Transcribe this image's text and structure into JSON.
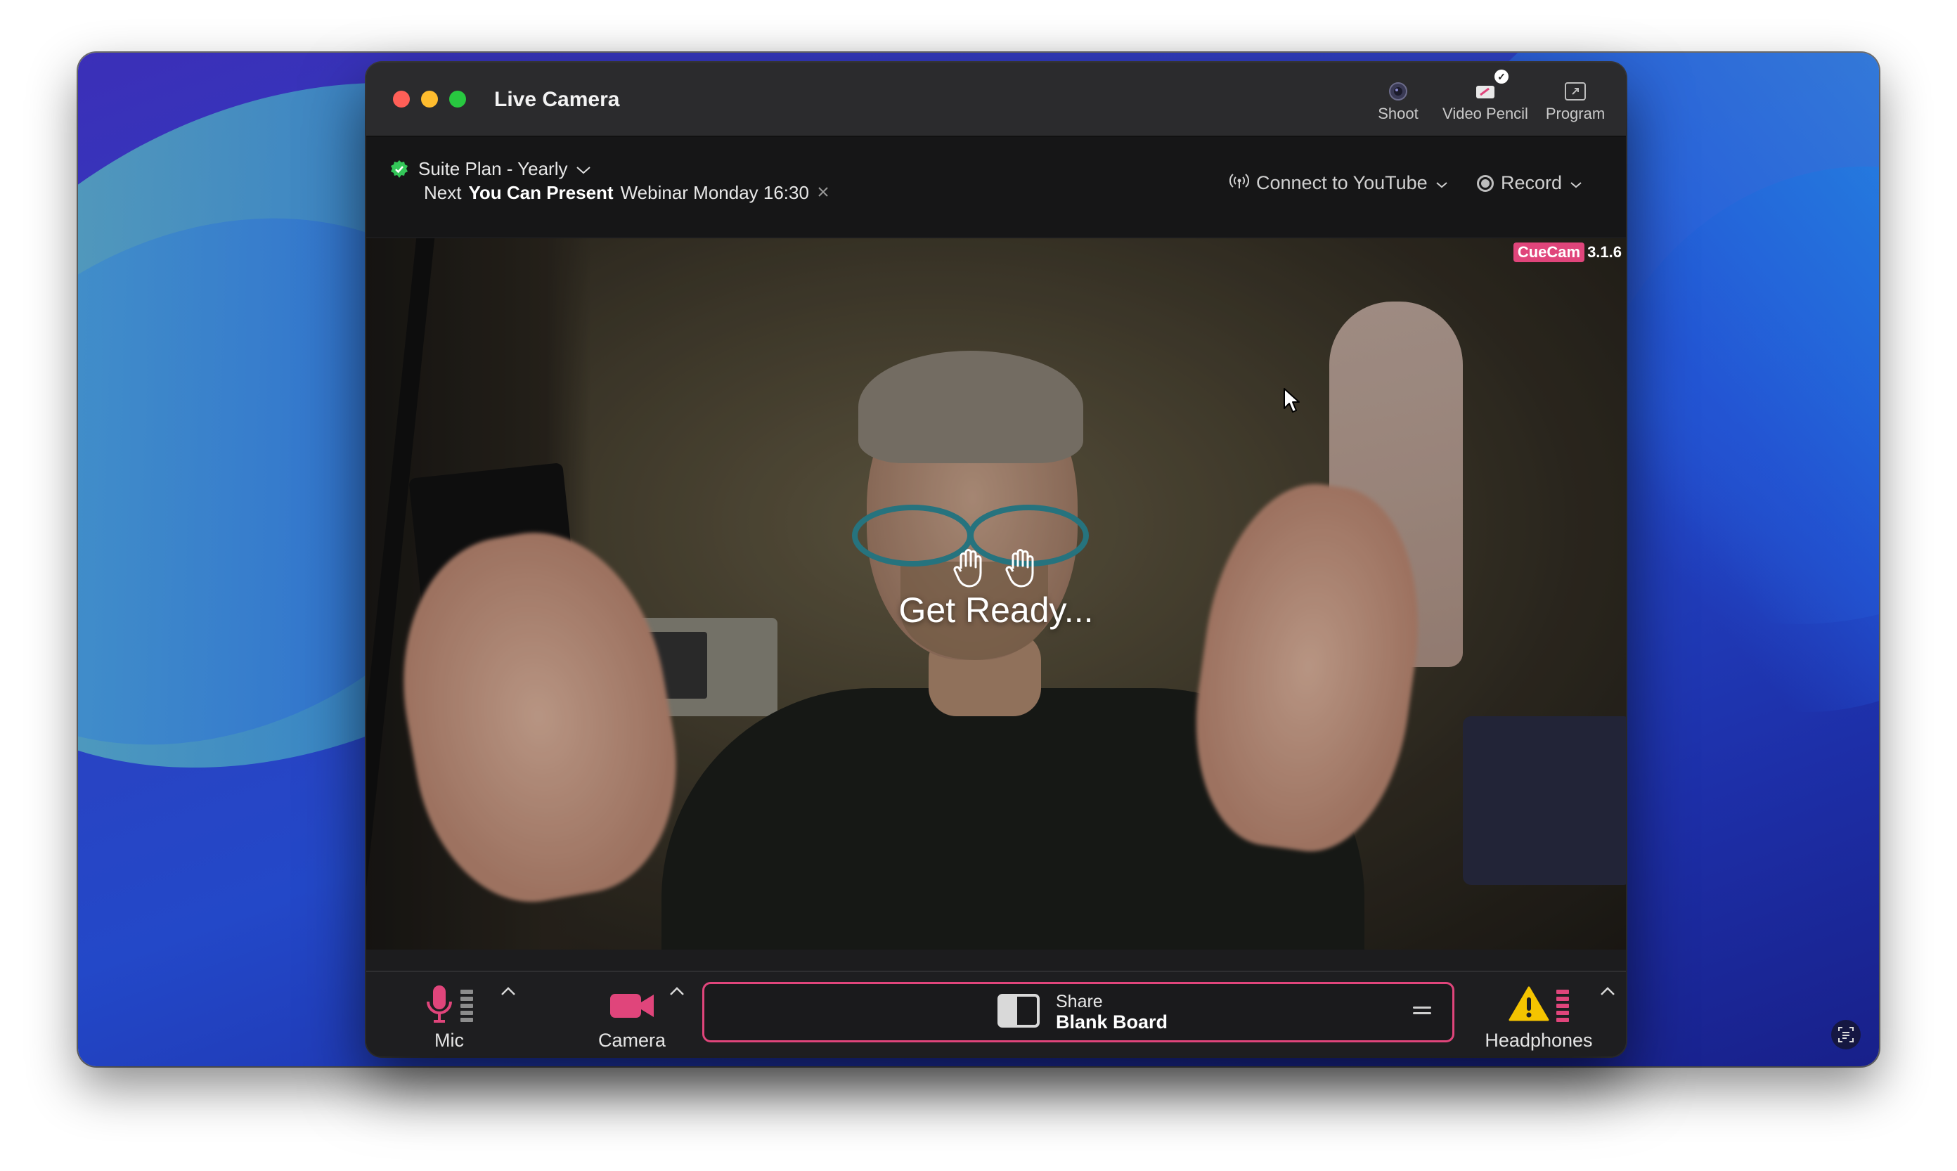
{
  "window": {
    "title": "Live Camera",
    "toolbar": [
      {
        "label": "Shoot",
        "icon": "webcam-icon"
      },
      {
        "label": "Video Pencil",
        "icon": "video-pencil-icon"
      },
      {
        "label": "Program",
        "icon": "expand-icon"
      }
    ]
  },
  "infobar": {
    "plan": "Suite Plan - Yearly",
    "next_prefix": "Next",
    "next_bold": "You Can Present",
    "next_suffix": "Webinar Monday 16:30",
    "connect_label": "Connect to YouTube",
    "record_label": "Record"
  },
  "video": {
    "brand": "CueCam",
    "version": "3.1.6",
    "overlay_text": "Get Ready..."
  },
  "bottombar": {
    "mic_label": "Mic",
    "camera_label": "Camera",
    "share_label": "Share",
    "share_value": "Blank Board",
    "headphones_label": "Headphones"
  },
  "colors": {
    "accent": "#e0457b",
    "warning": "#f5c400",
    "success": "#34c759"
  }
}
